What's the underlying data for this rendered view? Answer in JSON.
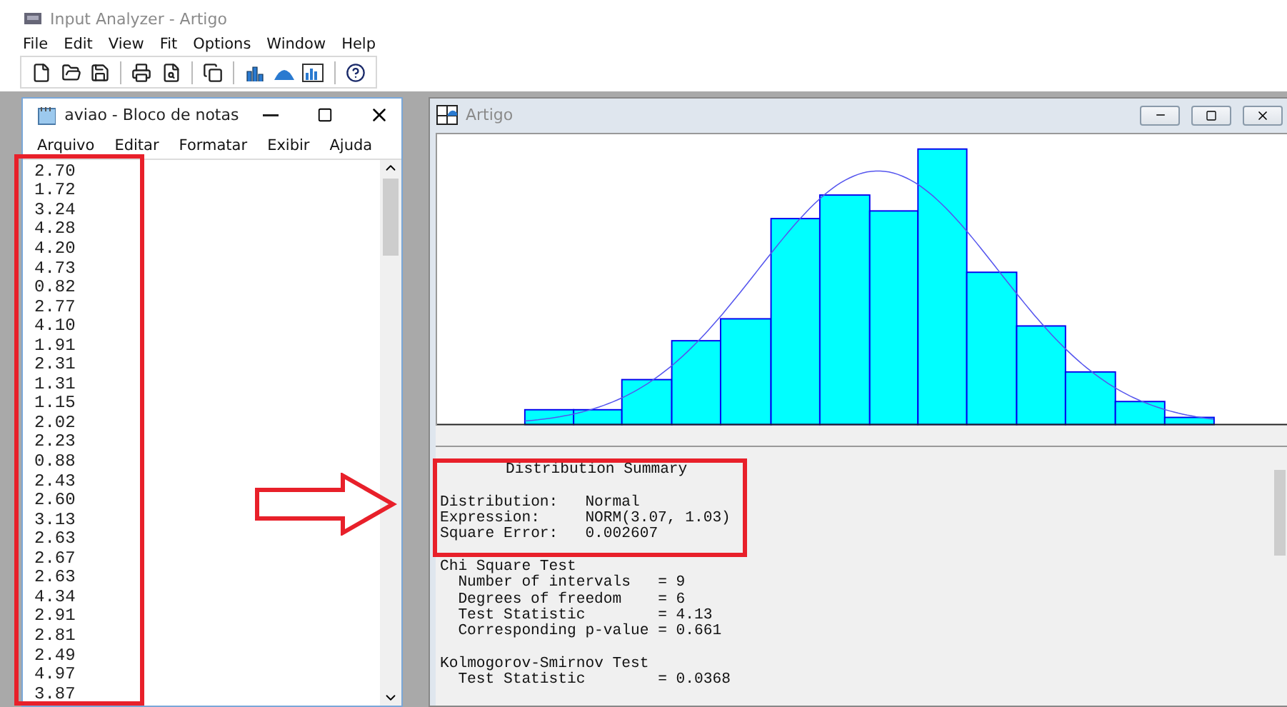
{
  "app": {
    "title": "Input Analyzer - Artigo",
    "menu": [
      "File",
      "Edit",
      "View",
      "Fit",
      "Options",
      "Window",
      "Help"
    ]
  },
  "notepad": {
    "title": "aviao - Bloco de notas",
    "menu": [
      "Arquivo",
      "Editar",
      "Formatar",
      "Exibir",
      "Ajuda"
    ],
    "lines": [
      "2.70",
      "1.72",
      "3.24",
      "4.28",
      "4.20",
      "4.73",
      "0.82",
      "2.77",
      "4.10",
      "1.91",
      "2.31",
      "1.31",
      "1.15",
      "2.02",
      "2.23",
      "0.88",
      "2.43",
      "2.60",
      "3.13",
      "2.63",
      "2.67",
      "2.63",
      "4.34",
      "2.91",
      "2.81",
      "2.49",
      "4.97",
      "3.87"
    ]
  },
  "analysis": {
    "title": "Artigo",
    "summary": {
      "title": "Distribution Summary",
      "rows": [
        {
          "label": "Distribution:",
          "value": "Normal"
        },
        {
          "label": "Expression:",
          "value": "NORM(3.07, 1.03)"
        },
        {
          "label": "Square Error:",
          "value": "0.002607"
        }
      ]
    },
    "tests": [
      {
        "title": "Chi Square Test",
        "rows": [
          {
            "label": "Number of intervals",
            "value": "= 9"
          },
          {
            "label": "Degrees of freedom",
            "value": "= 6"
          },
          {
            "label": "Test Statistic",
            "value": "= 4.13"
          },
          {
            "label": "Corresponding p-value",
            "value": "= 0.661"
          }
        ]
      },
      {
        "title": "Kolmogorov-Smirnov Test",
        "rows": [
          {
            "label": "Test Statistic",
            "value": "= 0.0368"
          }
        ]
      }
    ]
  }
}
